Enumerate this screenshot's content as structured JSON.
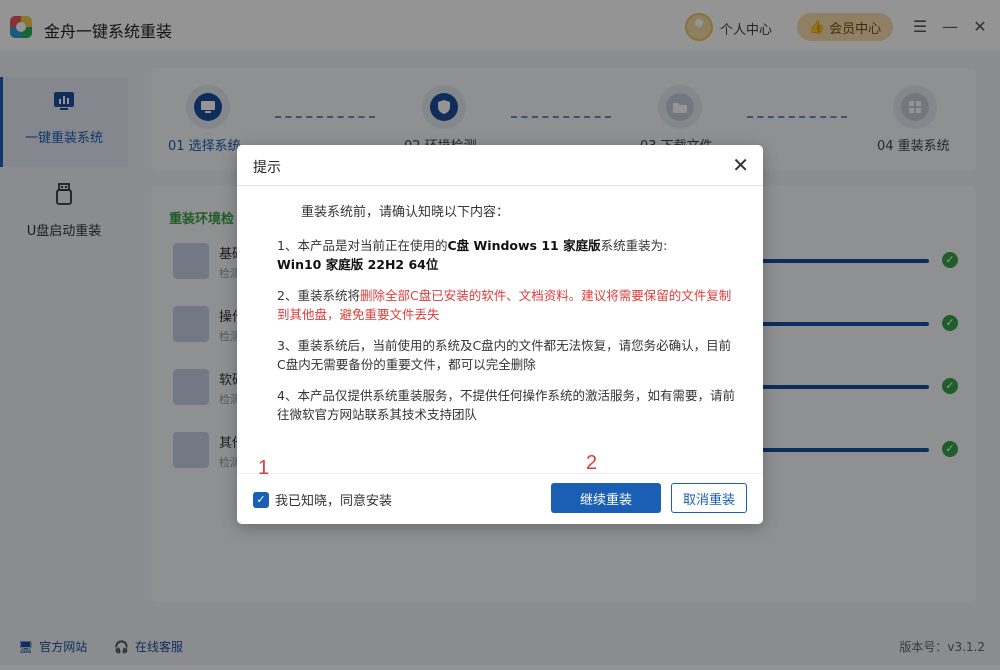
{
  "app": {
    "title": "金舟一键系统重装",
    "user_center": "个人中心",
    "vip_center": "会员中心"
  },
  "sidebar": {
    "items": [
      {
        "label": "一键重装系统",
        "icon": "monitor-chart-icon"
      },
      {
        "label": "U盘启动重装",
        "icon": "usb-drive-icon"
      }
    ]
  },
  "steps": [
    {
      "label": "01 选择系统",
      "icon": "monitor-icon"
    },
    {
      "label": "02 环境检测",
      "icon": "shield-icon"
    },
    {
      "label": "03 下载文件",
      "icon": "folder-icon"
    },
    {
      "label": "04 重装系统",
      "icon": "windows-icon"
    }
  ],
  "env": {
    "title": "重装环境检",
    "rows": [
      {
        "name": "基础",
        "sub": "检测"
      },
      {
        "name": "操作",
        "sub": "检测"
      },
      {
        "name": "软硬",
        "sub": "检测"
      },
      {
        "name": "其他",
        "sub": "检测"
      }
    ]
  },
  "footer": {
    "official_site": "官方网站",
    "online_service": "在线客服",
    "version": "版本号：v3.1.2"
  },
  "dialog": {
    "title": "提示",
    "lead": "重装系统前，请确认知晓以下内容：",
    "item1_prefix": "1、本产品是对当前正在使用的",
    "item1_bold": "C盘 Windows 11 家庭版",
    "item1_suffix": "系统重装为:",
    "item1_target": "Win10 家庭版 22H2 64位",
    "item2_prefix": "2、重装系统将",
    "item2_red": "删除全部C盘已安装的软件、文档资料。建议将需要保留的文件复制到其他盘，避免重要文件丢失",
    "item3": "3、重装系统后，当前使用的系统及C盘内的文件都无法恢复，请您务必确认，目前C盘内无需要备份的重要文件，都可以完全删除",
    "item4": "4、本产品仅提供系统重装服务，不提供任何操作系统的激活服务，如有需要，请前往微软官方网站联系其技术支持团队",
    "agree_label": "我已知晓，同意安装",
    "continue_label": "继续重装",
    "cancel_label": "取消重装"
  },
  "annotations": {
    "marker1": "1",
    "marker2": "2"
  },
  "colors": {
    "primary": "#1a5fb4",
    "success": "#3aa04a",
    "danger": "#e03b3b"
  }
}
